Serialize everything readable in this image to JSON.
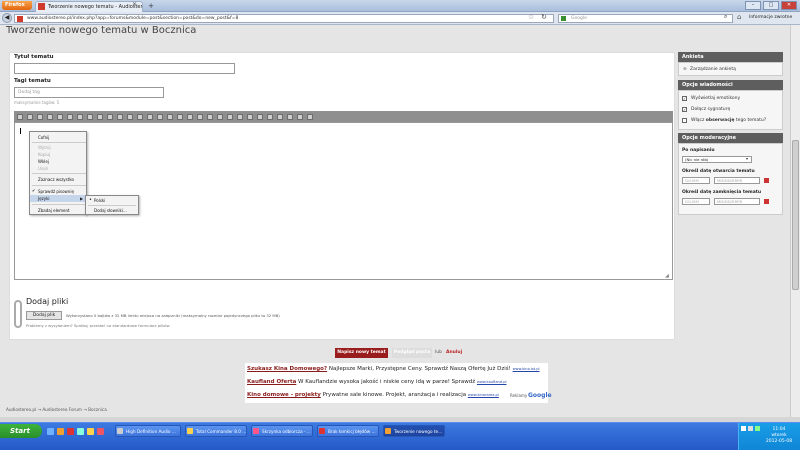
{
  "browser": {
    "firefox_label": "Firefox",
    "tab_title": "Tworzenie nowego tematu - Audiostereo.pl",
    "url": "www.audiostereo.pl/index.php?app=forums&module=post&section=post&do=new_post&f=8",
    "search_placeholder": "Google",
    "info_label": "Informacje zwrotne"
  },
  "page": {
    "heading": "Tworzenie nowego tematu w Bocznica",
    "title_label": "Tytuł tematu",
    "tags_label": "Tagi tematu",
    "tags_placeholder": "Dodaj tag",
    "tags_hint": "maksymalnie tagów: 5"
  },
  "context_menu": {
    "items": [
      "Cofnij",
      "Wytnij",
      "Kopiuj",
      "Wklej",
      "Usuń",
      "Zaznacz wszystko",
      "Sprawdź pisownię",
      "Języki",
      "Zbadaj element"
    ],
    "submenu": [
      "Polski",
      "Dodaj słowniki..."
    ]
  },
  "attach": {
    "title": "Dodaj pliki",
    "button": "Dodaj plik",
    "info": "Wykorzystano 0 bajtów z 32 MB limitu miejsca na załączniki (maksymalny rozmiar pojedynczego pliku to 32 MB)",
    "note": "Problemy z wysyłaniem? Spróbuj przesłać na standardowe formularz plików"
  },
  "sidebar": {
    "poll_header": "Ankieta",
    "poll_item": "Zarządzanie ankietą",
    "options_header": "Opcje wiadomości",
    "opt1": "Wyświetlaj emotikony",
    "opt2": "Dołącz sygnaturę",
    "opt3_pre": "Włącz",
    "opt3_bold": "obserwację",
    "opt3_post": "tego tematu?",
    "mod_header": "Opcje moderacyjne",
    "after_label": "Po napisaniu",
    "after_value": "(Nic nie rób)",
    "open_label": "Określ datę otwarcia tematu",
    "close_label": "Określ datę zamknięcia tematu",
    "time_ph": "GG:MM",
    "date_ph": "MM/DD/RRRR"
  },
  "actions": {
    "submit": "Napisz nowy temat",
    "preview": "Podgląd posta",
    "or": "lub",
    "cancel": "Anuluj"
  },
  "ads": [
    {
      "title": "Szukasz Kina Domowego?",
      "text": "Najlepsze Marki, Przystępne Ceny. Sprawdź Naszą Ofertę Już Dziś!",
      "url": "www.kino.ist.pl"
    },
    {
      "title": "Kaufland Oferta",
      "text": "W Kauflandzie wysoka jakość i niskie ceny idą w parze! Sprawdź",
      "url": "www.kaufland.pl"
    },
    {
      "title": "Kino domowe - projekty",
      "text": "Prywatne sale kinowe. Projekt, aranżacja i realizacja",
      "url": "www.kinorama.pl"
    }
  ],
  "adsby": "Reklamy",
  "google": "Google",
  "breadcrumb": "Audiostereo.pl  →  Audiostereo Forum  →  Bocznica",
  "taskbar": {
    "start": "Start",
    "items": [
      "High Definition Audio ...",
      "Total Commander 8.0 ...",
      "Skrzynka odbiorcza - ...",
      "Brak łamkicj błędów ...",
      "Tworzenie nowego te..."
    ],
    "time": "11:04",
    "day": "wtorek",
    "date": "2012-05-08"
  },
  "icons": {
    "firefox": "firefox-icon",
    "back": "back-arrow-icon",
    "star": "bookmark-star-icon",
    "reload": "reload-icon",
    "home": "home-icon",
    "search": "search-icon",
    "calendar": "calendar-icon"
  }
}
